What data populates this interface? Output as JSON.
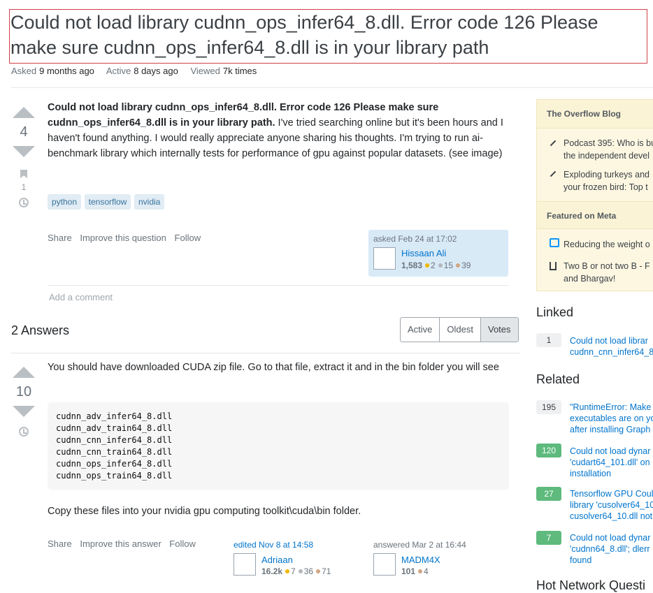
{
  "question": {
    "title": "Could not load library cudnn_ops_infer64_8.dll. Error code 126 Please make sure cudnn_ops_infer64_8.dll is in your library path",
    "asked_label": "Asked",
    "asked_value": "9 months ago",
    "active_label": "Active",
    "active_value": "8 days ago",
    "viewed_label": "Viewed",
    "viewed_value": "7k times",
    "votes": "4",
    "bookmarks": "1",
    "body_bold": "Could not load library cudnn_ops_infer64_8.dll. Error code 126 Please make sure cudnn_ops_infer64_8.dll is in your library path.",
    "body_text": " I've tried searching online but it's been hours and I haven't found anything. I would really appreciate anyone sharing his thoughts. I'm trying to run ai-benchmark library which internally tests for performance of gpu against popular datasets. (see image)",
    "tags": [
      "python",
      "tensorflow",
      "nvidia"
    ],
    "menu": {
      "share": "Share",
      "improve": "Improve this question",
      "follow": "Follow"
    },
    "asked_card": {
      "when": "asked Feb 24 at 17:02",
      "user": "Hissaan Ali",
      "rep": "1,583",
      "gold": "2",
      "silver": "15",
      "bronze": "39"
    },
    "add_comment": "Add a comment"
  },
  "answers_header": {
    "count_label": "2 Answers",
    "sort": [
      "Active",
      "Oldest",
      "Votes"
    ]
  },
  "answer": {
    "votes": "10",
    "text1": "You should have downloaded CUDA zip file. Go to that file, extract it and in the bin folder you will see",
    "code_lines": [
      "cudnn_adv_infer64_8.dll",
      "cudnn_adv_train64_8.dll",
      "cudnn_cnn_infer64_8.dll",
      "cudnn_cnn_train64_8.dll",
      "cudnn_ops_infer64_8.dll",
      "cudnn_ops_train64_8.dll"
    ],
    "text2": "Copy these files into your nvidia gpu computing toolkit\\cuda\\bin folder.",
    "menu": {
      "share": "Share",
      "improve": "Improve this answer",
      "follow": "Follow"
    },
    "edited": {
      "when": "edited Nov 8 at 14:58",
      "user": "Adriaan",
      "rep": "16.2k",
      "gold": "7",
      "silver": "36",
      "bronze": "71"
    },
    "answered": {
      "when": "answered Mar 2 at 16:44",
      "user": "MADM4X",
      "rep": "101",
      "bronze": "4"
    }
  },
  "sidebar": {
    "blog_title": "The Overflow Blog",
    "blog_items": [
      [
        "Podcast 395: Who is bu",
        "the independent devel"
      ],
      [
        "Exploding turkeys and",
        "your frozen bird: Top t"
      ]
    ],
    "meta_title": "Featured on Meta",
    "meta_items": [
      [
        "Reducing the weight o"
      ],
      [
        "Two B or not two B - F",
        "and Bhargav!"
      ]
    ],
    "linked_title": "Linked",
    "linked": [
      {
        "count": "1",
        "lines": [
          "Could not load librar",
          "cudnn_cnn_infer64_8"
        ]
      }
    ],
    "related_title": "Related",
    "related": [
      {
        "count": "195",
        "lines": [
          "\"RuntimeError: Make",
          "executables are on yo",
          "after installing Graph"
        ]
      },
      {
        "count": "120",
        "lines": [
          "Could not load dynar",
          "'cudart64_101.dll' on",
          "installation"
        ]
      },
      {
        "count": "27",
        "lines": [
          "Tensorflow GPU Coul",
          "library 'cusolver64_10",
          "cusolver64_10.dll not"
        ]
      },
      {
        "count": "7",
        "lines": [
          "Could not load dynar",
          "'cudnn64_8.dll'; dlerr",
          "found"
        ]
      }
    ],
    "hot_title": "Hot Network Questi"
  }
}
